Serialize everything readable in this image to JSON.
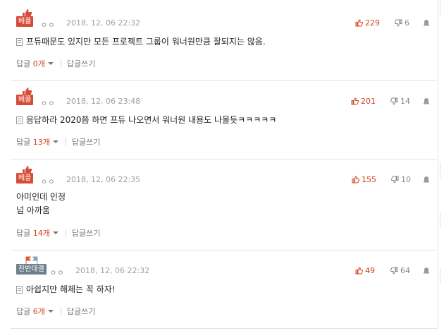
{
  "comments": [
    {
      "badge": "베플",
      "user": "ㅇㅇ",
      "date": "2018, 12, 06 22:32",
      "likes": "229",
      "dislikes": "6",
      "lines": [
        "프듀때문도 있지만 모든 프로젝트 그룹이 워너원만큼 잘되지는 않음."
      ],
      "reply_label": "답글",
      "reply_count": "0개",
      "write_reply": "답글쓰기"
    },
    {
      "badge": "베플",
      "user": "ㅇㅇ",
      "date": "2018, 12, 06 23:48",
      "likes": "201",
      "dislikes": "14",
      "lines": [
        "응답하라 2020쯤 하면 프듀 나오면서 워너원 내용도 나올듯ㅋㅋㅋㅋㅋ"
      ],
      "reply_label": "답글",
      "reply_count": "13개",
      "write_reply": "답글쓰기"
    },
    {
      "badge": "베플",
      "user": "ㅇㅇ",
      "date": "2018, 12, 06 22:35",
      "likes": "155",
      "dislikes": "10",
      "lines": [
        "아미인데 인정",
        "넘 아까움"
      ],
      "reply_label": "답글",
      "reply_count": "14개",
      "write_reply": "답글쓰기"
    },
    {
      "badge": "찬반대결",
      "user": "ㅇㅇ",
      "date": "2018, 12, 06 22:32",
      "likes": "49",
      "dislikes": "64",
      "lines": [
        "아쉽지만 해체는 꼭 하자!"
      ],
      "reply_label": "답글",
      "reply_count": "6개",
      "write_reply": "답글쓰기"
    }
  ],
  "colors": {
    "accent": "#d0421b",
    "badge_red": "#d64c38",
    "badge_gray": "#6e7f8c"
  }
}
